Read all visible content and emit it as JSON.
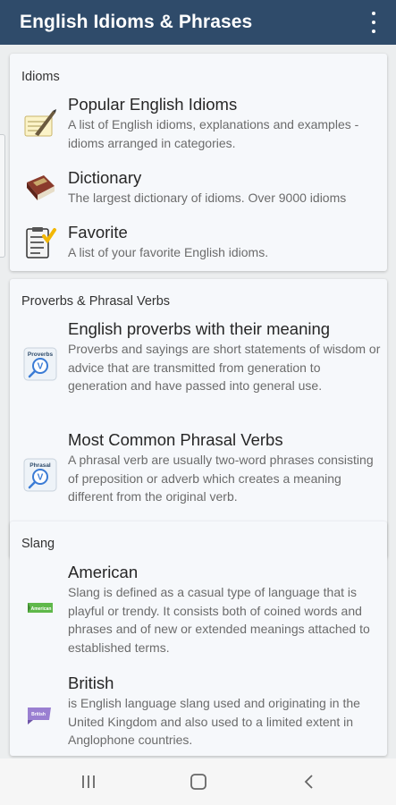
{
  "app": {
    "title": "English Idioms & Phrases",
    "menu_icon": "more-vert-icon"
  },
  "colors": {
    "appbar": "#2f4b6a",
    "card_bg": "#f6f8fb",
    "page_bg": "#eceeef"
  },
  "sections": [
    {
      "heading": "Idioms",
      "items": [
        {
          "title": "Popular English Idioms",
          "desc": "A list of English idioms, explanations and examples - idioms arranged in categories.",
          "icon": "idioms-quill-icon"
        },
        {
          "title": "Dictionary",
          "desc": "The largest dictionary of idioms. Over 9000 idioms",
          "icon": "dictionary-book-icon"
        },
        {
          "title": "Favorite",
          "desc": "A list of your favorite English idioms.",
          "icon": "favorite-checklist-icon"
        }
      ]
    },
    {
      "heading": "Proverbs & Phrasal Verbs",
      "items": [
        {
          "title": "English proverbs with their meaning",
          "desc": "Proverbs and sayings are short statements of wisdom or advice that are transmitted from generation to generation and have passed into general use.",
          "icon": "proverbs-magnifier-icon",
          "icon_text": "Proverbs"
        },
        {
          "title": "Most Common Phrasal Verbs",
          "desc": "A phrasal verb are usually two-word phrases consisting of preposition or adverb which creates a meaning different from the original verb.",
          "icon": "phrasal-magnifier-icon",
          "icon_text": "Phrasal"
        }
      ]
    },
    {
      "heading": "Slang",
      "items": [
        {
          "title": "American",
          "desc": "Slang is defined as a casual type of language that is playful or trendy. It consists both of coined words and phrases and of new or extended meanings attached to established terms.",
          "icon": "american-slang-flag-icon",
          "icon_text": "American"
        },
        {
          "title": "British",
          "desc": "is English language slang used and originating in the United Kingdom and also used to a limited extent in Anglophone countries.",
          "icon": "british-slang-flag-icon",
          "icon_text": "British"
        }
      ]
    }
  ],
  "navbar": {
    "recent": "recent-apps-icon",
    "home": "home-icon",
    "back": "back-icon"
  }
}
